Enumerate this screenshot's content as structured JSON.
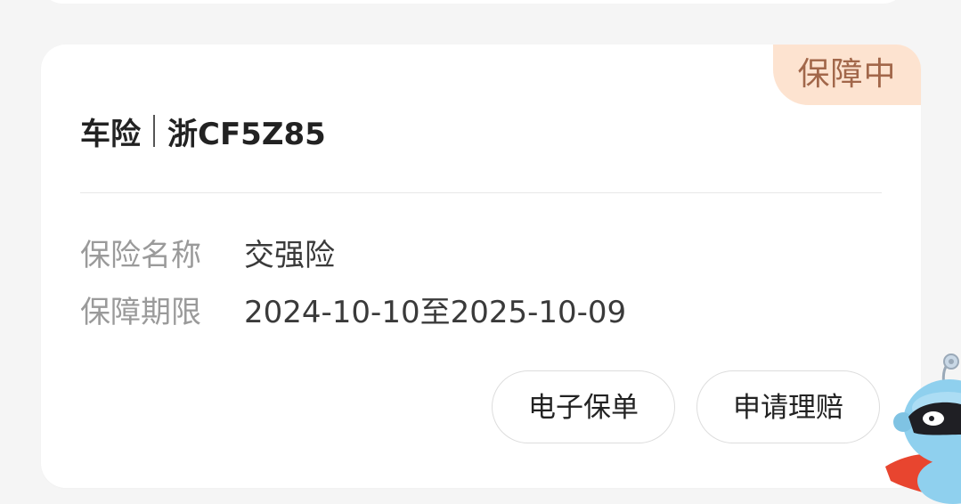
{
  "card": {
    "status": "保障中",
    "category": "车险",
    "plate": "浙CF5Z85",
    "fields": [
      {
        "label": "保险名称",
        "value": "交强险"
      },
      {
        "label": "保障期限",
        "value": "2024-10-10至2025-10-09"
      }
    ],
    "actions": {
      "policy_label": "电子保单",
      "claim_label": "申请理赔"
    }
  },
  "colors": {
    "badge_bg": "#fde3d0",
    "badge_text": "#a2674a",
    "mascot_body": "#8fd0ee",
    "mascot_cape": "#e8452f"
  },
  "icons": {
    "mascot": "robot-mascot-icon"
  }
}
